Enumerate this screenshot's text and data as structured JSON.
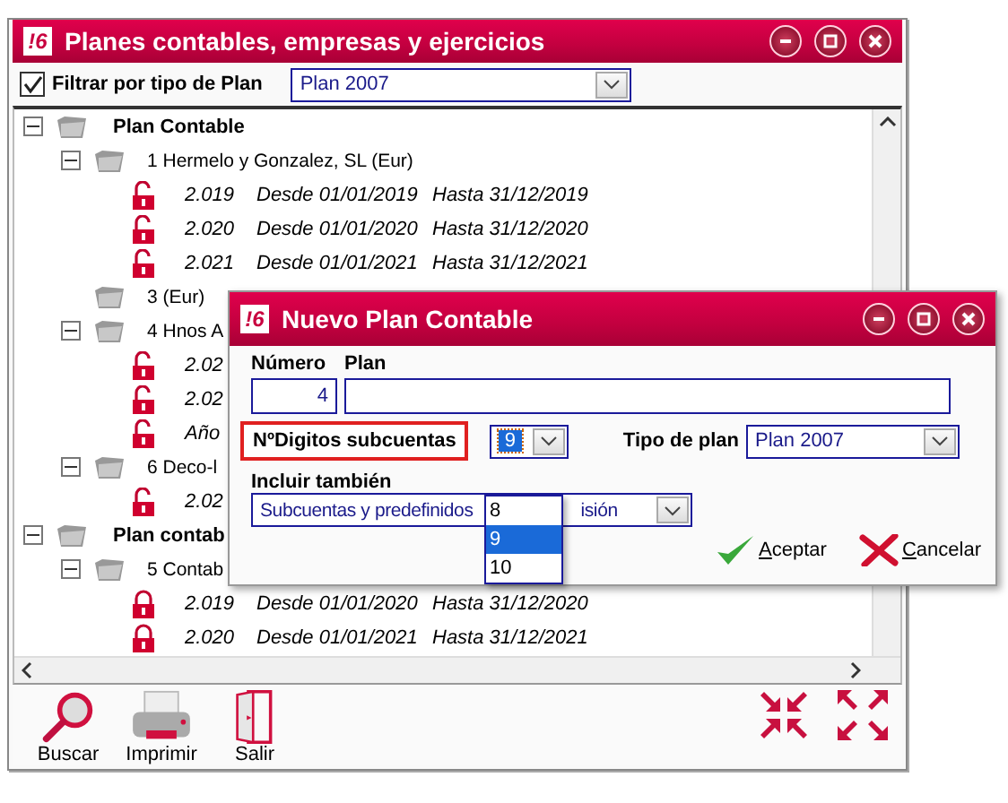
{
  "window": {
    "logo": "!6",
    "title": "Planes contables, empresas y ejercicios"
  },
  "filter": {
    "checked": true,
    "label": "Filtrar por tipo de Plan",
    "value": "Plan 2007"
  },
  "tree": [
    {
      "kind": "plan",
      "label": "Plan Contable",
      "expanded": true,
      "children": [
        {
          "kind": "company",
          "label": "1 Hermelo y Gonzalez, SL (Eur)",
          "expanded": true,
          "children": [
            {
              "kind": "period",
              "locked": false,
              "columns": [
                "2.019",
                "Desde 01/01/2019",
                "Hasta 31/12/2019"
              ]
            },
            {
              "kind": "period",
              "locked": false,
              "columns": [
                "2.020",
                "Desde 01/01/2020",
                "Hasta 31/12/2020"
              ]
            },
            {
              "kind": "period",
              "locked": false,
              "columns": [
                "2.021",
                "Desde 01/01/2021",
                "Hasta 31/12/2021"
              ]
            }
          ]
        },
        {
          "kind": "company",
          "label": "3  (Eur)"
        },
        {
          "kind": "company",
          "label": "4 Hnos A",
          "expanded": true,
          "children": [
            {
              "kind": "period",
              "locked": false,
              "columns": [
                "2.02"
              ]
            },
            {
              "kind": "period",
              "locked": false,
              "columns": [
                "2.02"
              ]
            },
            {
              "kind": "period",
              "locked": false,
              "columns": [
                "Año"
              ]
            }
          ]
        },
        {
          "kind": "company",
          "label": "6 Deco-l",
          "expanded": true,
          "children": [
            {
              "kind": "period",
              "locked": false,
              "columns": [
                "2.02"
              ]
            }
          ]
        }
      ]
    },
    {
      "kind": "plan",
      "label": "Plan contab",
      "expanded": true,
      "children": [
        {
          "kind": "company",
          "label": "5 Contab",
          "expanded": true,
          "children": [
            {
              "kind": "period",
              "locked": true,
              "columns": [
                "2.019",
                "Desde 01/01/2020",
                "Hasta 31/12/2020"
              ]
            },
            {
              "kind": "period",
              "locked": true,
              "columns": [
                "2.020",
                "Desde 01/01/2021",
                "Hasta 31/12/2021"
              ]
            }
          ]
        }
      ]
    }
  ],
  "toolbar": [
    {
      "kind": "search",
      "label": "Buscar"
    },
    {
      "kind": "print",
      "label": "Imprimir"
    },
    {
      "kind": "exit",
      "label": "Salir"
    }
  ],
  "dialog": {
    "logo": "!6",
    "title": "Nuevo Plan Contable",
    "number": {
      "label": "Número",
      "value": "4"
    },
    "plan": {
      "label": "Plan"
    },
    "digits": {
      "label": "NºDigitos subcuentas",
      "value": "9",
      "options": [
        {
          "label": "8",
          "selected": false
        },
        {
          "label": "9",
          "selected": true
        },
        {
          "label": "10",
          "selected": false
        }
      ]
    },
    "plan_type": {
      "label": "Tipo de plan",
      "value": "Plan 2007"
    },
    "include": {
      "label": "Incluir también",
      "value_parts": [
        "Subcuentas y predefinidos",
        "isión"
      ]
    },
    "buttons": [
      {
        "kind": "accept",
        "label": "Aceptar"
      },
      {
        "kind": "cancel",
        "label": "Cancelar"
      }
    ]
  }
}
